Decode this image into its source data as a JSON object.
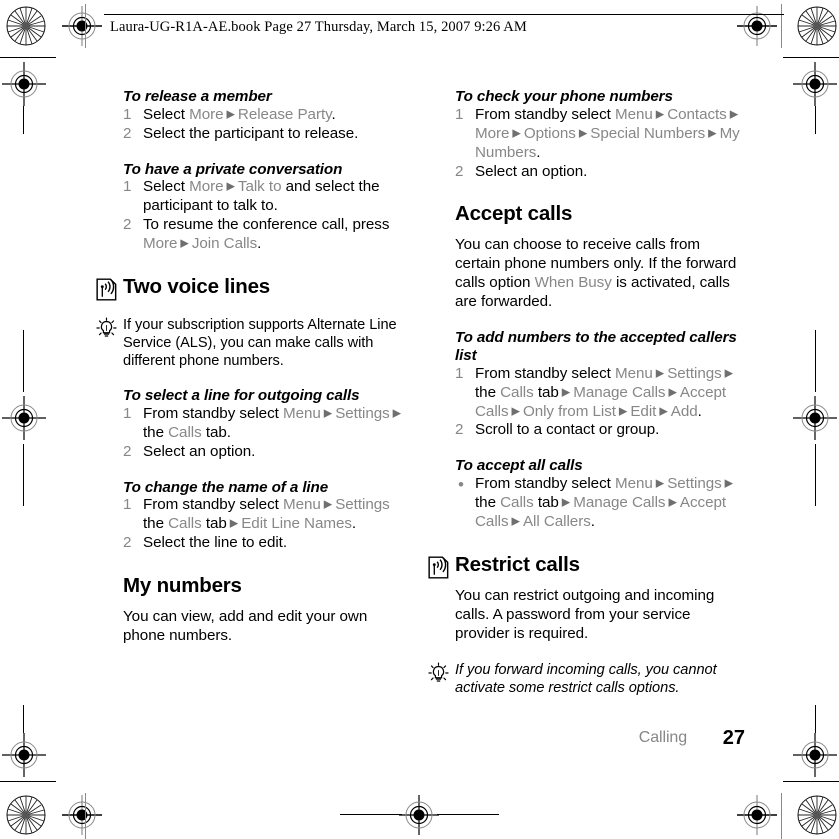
{
  "header": {
    "file_info": "Laura-UG-R1A-AE.book  Page 27  Thursday, March 15, 2007  9:26 AM"
  },
  "left_column": {
    "sections": [
      {
        "kind": "procedure",
        "heading": "To release a member",
        "steps": [
          {
            "marker": "1",
            "parts": [
              {
                "t": "Select ",
                "s": "black"
              },
              {
                "t": "More",
                "s": "gray"
              },
              {
                "t": " ▶ ",
                "s": "arrow"
              },
              {
                "t": "Release Party",
                "s": "gray"
              },
              {
                "t": ".",
                "s": "black"
              }
            ]
          },
          {
            "marker": "2",
            "parts": [
              {
                "t": "Select the participant to release.",
                "s": "black"
              }
            ]
          }
        ]
      },
      {
        "kind": "procedure",
        "heading": "To have a private conversation",
        "steps": [
          {
            "marker": "1",
            "parts": [
              {
                "t": "Select ",
                "s": "black"
              },
              {
                "t": "More",
                "s": "gray"
              },
              {
                "t": " ▶ ",
                "s": "arrow"
              },
              {
                "t": "Talk to",
                "s": "gray"
              },
              {
                "t": " and select the participant to talk to.",
                "s": "black"
              }
            ]
          },
          {
            "marker": "2",
            "parts": [
              {
                "t": "To resume the conference call, press ",
                "s": "black"
              },
              {
                "t": "More",
                "s": "gray"
              },
              {
                "t": " ▶ ",
                "s": "arrow"
              },
              {
                "t": "Join Calls",
                "s": "gray"
              },
              {
                "t": ".",
                "s": "black"
              }
            ]
          }
        ]
      },
      {
        "kind": "chapter-heading",
        "icon": "signal-waves-icon",
        "title": "Two voice lines"
      },
      {
        "kind": "note",
        "icon": "lightbulb-tip-icon",
        "italic": false,
        "text": "If your subscription supports Alternate Line Service (ALS), you can make calls with different phone numbers."
      },
      {
        "kind": "procedure",
        "heading": "To select a line for outgoing calls",
        "steps": [
          {
            "marker": "1",
            "parts": [
              {
                "t": "From standby select ",
                "s": "black"
              },
              {
                "t": "Menu",
                "s": "gray"
              },
              {
                "t": " ▶ ",
                "s": "arrow"
              },
              {
                "t": "Settings",
                "s": "gray"
              },
              {
                "t": " ▶ ",
                "s": "arrow"
              },
              {
                "t": "the ",
                "s": "black"
              },
              {
                "t": "Calls",
                "s": "gray"
              },
              {
                "t": " tab.",
                "s": "black"
              }
            ]
          },
          {
            "marker": "2",
            "parts": [
              {
                "t": "Select an option.",
                "s": "black"
              }
            ]
          }
        ]
      },
      {
        "kind": "procedure",
        "heading": "To change the name of a line",
        "steps": [
          {
            "marker": "1",
            "parts": [
              {
                "t": "From standby select ",
                "s": "black"
              },
              {
                "t": "Menu",
                "s": "gray"
              },
              {
                "t": " ▶ ",
                "s": "arrow"
              },
              {
                "t": "Settings",
                "s": "gray"
              },
              {
                "t": " the ",
                "s": "black"
              },
              {
                "t": "Calls",
                "s": "gray"
              },
              {
                "t": " tab",
                "s": "black"
              },
              {
                "t": " ▶ ",
                "s": "arrow"
              },
              {
                "t": "Edit Line Names",
                "s": "gray"
              },
              {
                "t": ".",
                "s": "black"
              }
            ]
          },
          {
            "marker": "2",
            "parts": [
              {
                "t": "Select the line to edit.",
                "s": "black"
              }
            ]
          }
        ]
      },
      {
        "kind": "chapter-heading",
        "icon": "none",
        "title": "My numbers"
      },
      {
        "kind": "paragraph",
        "text": "You can view, add and edit your own phone numbers."
      }
    ]
  },
  "right_column": {
    "sections": [
      {
        "kind": "procedure",
        "heading": "To check your phone numbers",
        "steps": [
          {
            "marker": "1",
            "parts": [
              {
                "t": "From standby select ",
                "s": "black"
              },
              {
                "t": "Menu",
                "s": "gray"
              },
              {
                "t": " ▶ ",
                "s": "arrow"
              },
              {
                "t": "Contacts",
                "s": "gray"
              },
              {
                "t": " ▶ ",
                "s": "arrow"
              },
              {
                "t": "More",
                "s": "gray"
              },
              {
                "t": " ▶ ",
                "s": "arrow"
              },
              {
                "t": "Options",
                "s": "gray"
              },
              {
                "t": " ▶ ",
                "s": "arrow"
              },
              {
                "t": "Special Numbers",
                "s": "gray"
              },
              {
                "t": " ▶ ",
                "s": "arrow"
              },
              {
                "t": "My Numbers",
                "s": "gray"
              },
              {
                "t": ".",
                "s": "black"
              }
            ]
          },
          {
            "marker": "2",
            "parts": [
              {
                "t": "Select an option.",
                "s": "black"
              }
            ]
          }
        ]
      },
      {
        "kind": "chapter-heading",
        "icon": "none",
        "title": "Accept calls"
      },
      {
        "kind": "paragraph-mixed",
        "parts": [
          {
            "t": "You can choose to receive calls from certain phone numbers only. If the forward calls option ",
            "s": "black"
          },
          {
            "t": "When Busy",
            "s": "gray"
          },
          {
            "t": " is activated, calls are forwarded.",
            "s": "black"
          }
        ]
      },
      {
        "kind": "procedure",
        "heading": "To add numbers to the accepted callers list",
        "steps": [
          {
            "marker": "1",
            "parts": [
              {
                "t": "From standby select ",
                "s": "black"
              },
              {
                "t": "Menu",
                "s": "gray"
              },
              {
                "t": " ▶ ",
                "s": "arrow"
              },
              {
                "t": "Settings",
                "s": "gray"
              },
              {
                "t": " ▶ ",
                "s": "arrow"
              },
              {
                "t": "the ",
                "s": "black"
              },
              {
                "t": "Calls",
                "s": "gray"
              },
              {
                "t": " tab",
                "s": "black"
              },
              {
                "t": " ▶ ",
                "s": "arrow"
              },
              {
                "t": "Manage Calls",
                "s": "gray"
              },
              {
                "t": " ▶ ",
                "s": "arrow"
              },
              {
                "t": "Accept Calls",
                "s": "gray"
              },
              {
                "t": " ▶ ",
                "s": "arrow"
              },
              {
                "t": "Only from List",
                "s": "gray"
              },
              {
                "t": " ▶ ",
                "s": "arrow"
              },
              {
                "t": "Edit",
                "s": "gray"
              },
              {
                "t": " ▶ ",
                "s": "arrow"
              },
              {
                "t": "Add",
                "s": "gray"
              },
              {
                "t": ".",
                "s": "black"
              }
            ]
          },
          {
            "marker": "2",
            "parts": [
              {
                "t": "Scroll to a contact or group.",
                "s": "black"
              }
            ]
          }
        ]
      },
      {
        "kind": "procedure",
        "heading": "To accept all calls",
        "steps": [
          {
            "marker": "•",
            "parts": [
              {
                "t": "From standby select ",
                "s": "black"
              },
              {
                "t": "Menu",
                "s": "gray"
              },
              {
                "t": " ▶ ",
                "s": "arrow"
              },
              {
                "t": "Settings",
                "s": "gray"
              },
              {
                "t": " ▶ ",
                "s": "arrow"
              },
              {
                "t": "the ",
                "s": "black"
              },
              {
                "t": "Calls",
                "s": "gray"
              },
              {
                "t": " tab",
                "s": "black"
              },
              {
                "t": " ▶ ",
                "s": "arrow"
              },
              {
                "t": "Manage Calls",
                "s": "gray"
              },
              {
                "t": " ▶ ",
                "s": "arrow"
              },
              {
                "t": "Accept Calls",
                "s": "gray"
              },
              {
                "t": " ▶ ",
                "s": "arrow"
              },
              {
                "t": "All Callers",
                "s": "gray"
              },
              {
                "t": ".",
                "s": "black"
              }
            ]
          }
        ]
      },
      {
        "kind": "chapter-heading",
        "icon": "signal-waves-icon",
        "title": "Restrict calls"
      },
      {
        "kind": "paragraph",
        "text": "You can restrict outgoing and incoming calls. A password from your service provider is required."
      },
      {
        "kind": "note",
        "icon": "lightbulb-tip-icon",
        "italic": true,
        "text": "If you forward incoming calls, you cannot activate some restrict calls options."
      }
    ]
  },
  "footer": {
    "chapter": "Calling",
    "page_number": "27"
  },
  "colors": {
    "menu_gray": "#878787",
    "text_black": "#000000",
    "page_background": "#ffffff"
  }
}
